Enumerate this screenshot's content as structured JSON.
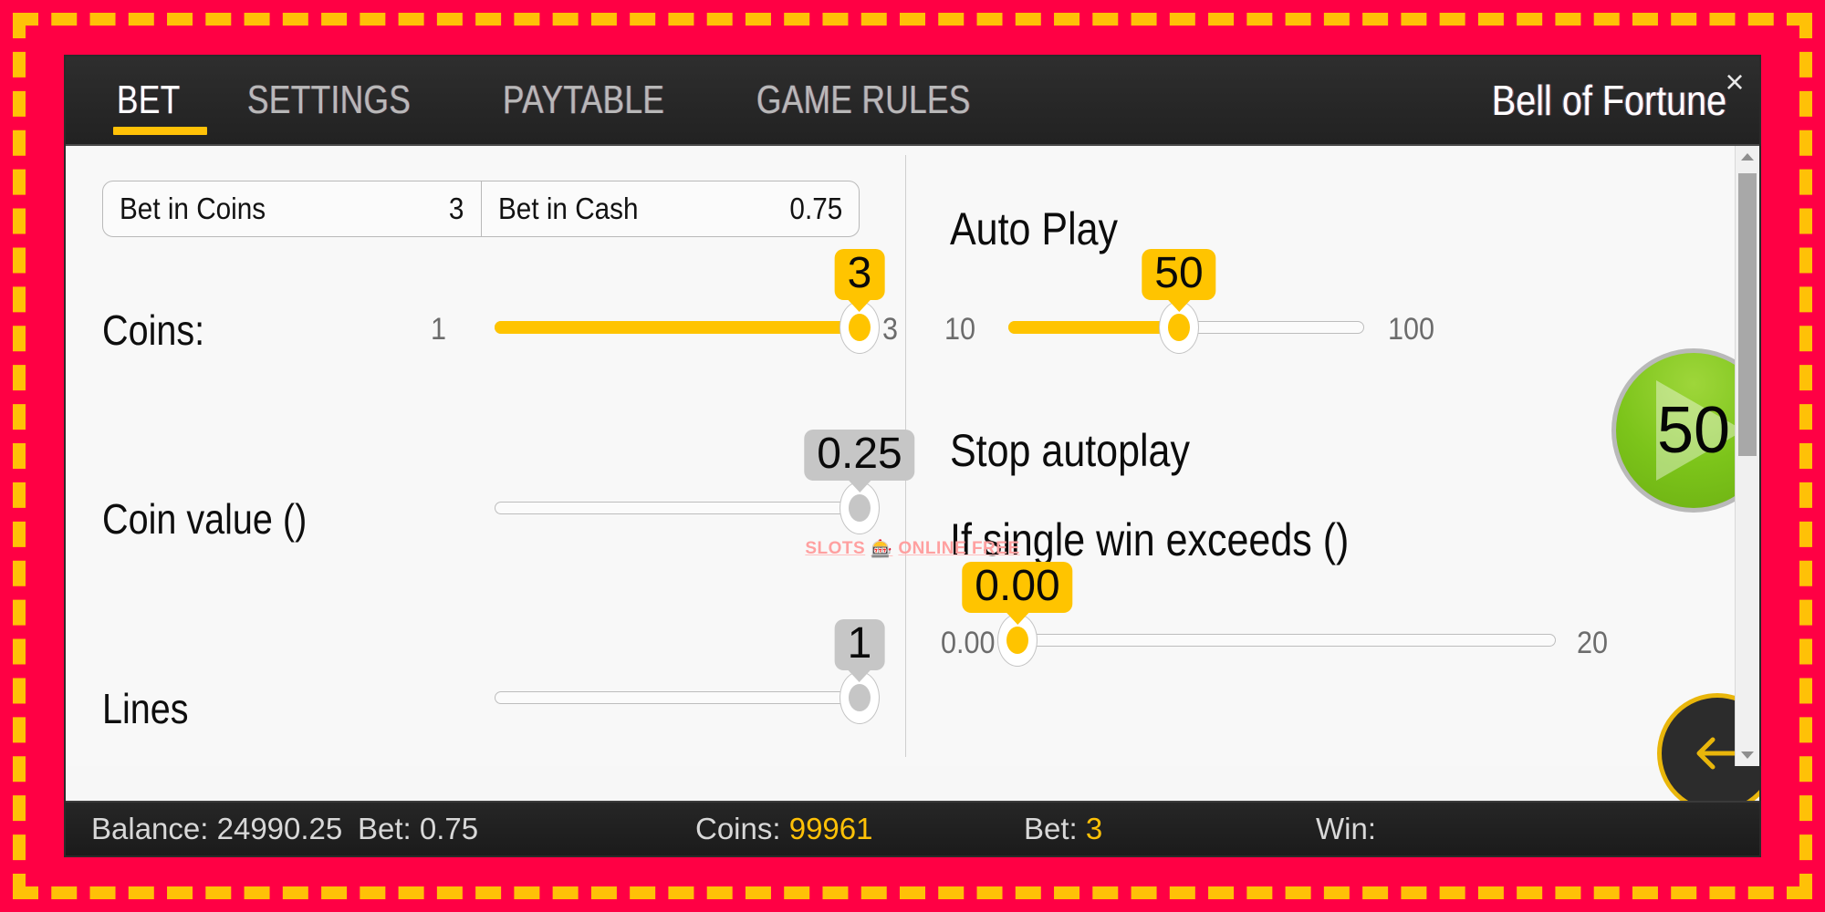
{
  "frame": {
    "outer_color": "#FF0044",
    "dash_color": "#FFC107"
  },
  "window": {
    "title": "Bell of Fortune",
    "close_label": "×",
    "tabs": [
      {
        "label": "BET",
        "active": true
      },
      {
        "label": "SETTINGS",
        "active": false
      },
      {
        "label": "PAYTABLE",
        "active": false
      },
      {
        "label": "GAME RULES",
        "active": false
      }
    ]
  },
  "bet_fields": [
    {
      "label": "Bet in Coins",
      "value": "3"
    },
    {
      "label": "Bet in Cash",
      "value": "0.75"
    }
  ],
  "left": {
    "coins": {
      "label": "Coins:",
      "min_label": "1",
      "max_label": "3",
      "bubble": "3",
      "percent": 100,
      "enabled": true
    },
    "coin_value": {
      "label": "Coin value ()",
      "bubble": "0.25",
      "percent": 100,
      "enabled": false
    },
    "lines": {
      "label": "Lines",
      "bubble": "1",
      "percent": 100,
      "enabled": false
    }
  },
  "right": {
    "auto_play": {
      "heading": "Auto Play",
      "min_label": "10",
      "max_label": "100",
      "bubble": "50",
      "percent": 48,
      "enabled": true
    },
    "stop_autoplay_heading": "Stop autoplay",
    "single_win": {
      "heading": "If single win exceeds ()",
      "min_label": "0.00",
      "max_label": "20",
      "bubble": "0.00",
      "percent": 0,
      "enabled": true
    },
    "spin_button": {
      "value": "50",
      "color": "#7cc41a"
    },
    "back_button": {
      "icon": "arrow-left-icon",
      "color": "#FFC107"
    }
  },
  "watermark": {
    "text_before": "SLOTS",
    "glyph": "🎰",
    "text_after": "ONLINE FREE"
  },
  "status": {
    "balance_label": "Balance:",
    "balance_value": "24990.25",
    "bet_cash_label": "Bet:",
    "bet_cash_value": "0.75",
    "coins_label": "Coins:",
    "coins_value": "99961",
    "bet_coins_label": "Bet:",
    "bet_coins_value": "3",
    "win_label": "Win:",
    "win_value": ""
  },
  "scrollbar": {
    "up_icon": "chevron-up-icon",
    "down_icon": "chevron-down-icon"
  }
}
